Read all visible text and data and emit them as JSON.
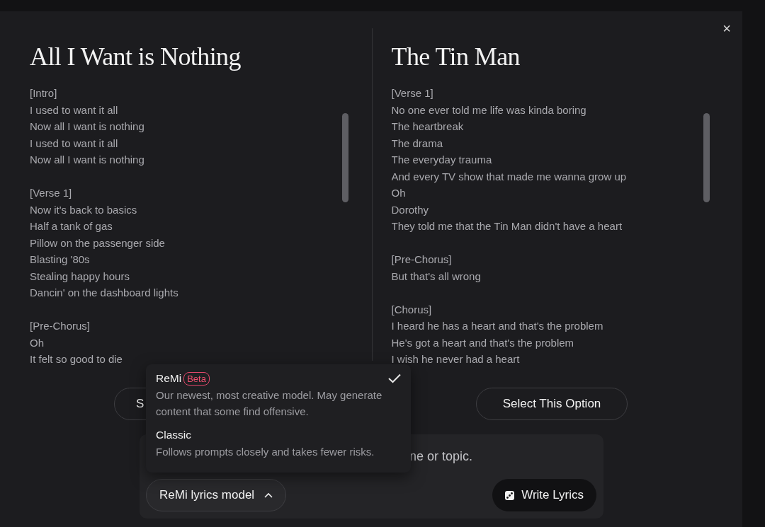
{
  "options": [
    {
      "title": "All I Want is Nothing",
      "lyrics": [
        [
          "[Intro]",
          "I used to want it all",
          "Now all I want is nothing",
          "I used to want it all",
          "Now all I want is nothing"
        ],
        [
          "[Verse 1]",
          "Now it's back to basics",
          "Half a tank of gas",
          "Pillow on the passenger side",
          "Blasting '80s",
          "Stealing happy hours",
          "Dancin' on the dashboard lights"
        ],
        [
          "[Pre-Chorus]",
          "Oh",
          "It felt so good to die"
        ]
      ],
      "button": "S"
    },
    {
      "title": "The Tin Man",
      "lyrics": [
        [
          "[Verse 1]",
          "No one ever told me life was kinda boring",
          "The heartbreak",
          "The drama",
          "The everyday trauma",
          "And every TV show that made me wanna grow up",
          "Oh",
          "Dorothy",
          "They told me that the Tin Man didn't have a heart"
        ],
        [
          "[Pre-Chorus]",
          "But that's all wrong"
        ],
        [
          "[Chorus]",
          "I heard he has a heart and that's the problem",
          "He's got a heart and that's the problem",
          "I wish he never had a heart"
        ]
      ],
      "button": "Select This Option"
    }
  ],
  "close": "×",
  "prompt": {
    "placeholder": "ne or topic."
  },
  "model_menu": {
    "expanded": true,
    "label": "ReMi lyrics model",
    "items": [
      {
        "name": "ReMi",
        "badge": "Beta",
        "description": "Our newest, most creative model. May generate content that some find offensive.",
        "selected": true
      },
      {
        "name": "Classic",
        "description": "Follows prompts closely and takes fewer risks.",
        "selected": false
      }
    ]
  },
  "write_button": "Write Lyrics"
}
